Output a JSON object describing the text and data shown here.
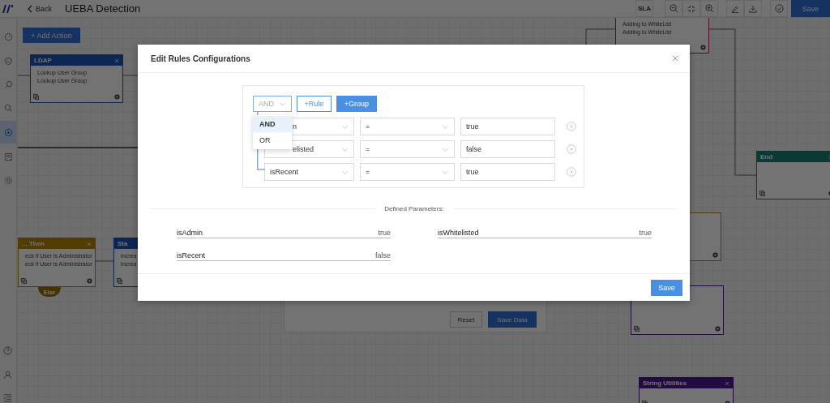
{
  "top_bar": {
    "back": "Back",
    "title": "UEBA Detection",
    "sla": "SLA",
    "save": "Save"
  },
  "sidebar": {
    "items": [
      {
        "selected": false
      },
      {
        "selected": false
      },
      {
        "selected": false
      },
      {
        "selected": false
      },
      {
        "selected": true
      },
      {
        "selected": false
      },
      {
        "selected": false
      }
    ]
  },
  "add_action": "+ Add Action",
  "nodes": [
    {
      "title": "LDAP",
      "lines": [
        "Lookup User Group",
        "Lookup User Group"
      ],
      "kind": "action"
    },
    {
      "lines": [
        "Adding to WhiteList",
        "Adding to WhiteList"
      ],
      "kind": "list"
    },
    {
      "title": "End",
      "kind": "end"
    },
    {
      "title": "... Then",
      "lines": [
        "eck if User is Administrator",
        "eck if User is Administrator"
      ],
      "kind": "condition"
    },
    {
      "title": "Sta",
      "lines": [
        "Increa",
        "Increa"
      ],
      "kind": "action"
    },
    {
      "kind": "condition"
    },
    {
      "kind": "utility"
    },
    {
      "title": "String Utilities",
      "kind": "utility"
    }
  ],
  "else_tab": "Else",
  "back_panel": {
    "buttons": [
      "Reset",
      "Save Data"
    ]
  },
  "dialog": {
    "title": "Edit Rules Configurations",
    "combinator": {
      "value": "AND",
      "expanded": true,
      "options": [
        {
          "label": "AND",
          "selected": true
        },
        {
          "label": "OR",
          "selected": false
        }
      ]
    },
    "add_rule": "+Rule",
    "add_group": "+Group",
    "rules": [
      {
        "field": "n",
        "operator": "=",
        "value": "true"
      },
      {
        "field": "elisted",
        "operator": "=",
        "value": "false"
      },
      {
        "field": "isRecent",
        "operator": "=",
        "value": "true"
      }
    ],
    "parameters_heading": "Defined Parameters:",
    "parameters": [
      {
        "name": "isAdmin",
        "value": "true"
      },
      {
        "name": "isWhitelisted",
        "value": "true"
      },
      {
        "name": "isRecent",
        "value": "false"
      }
    ],
    "save": "Save"
  }
}
